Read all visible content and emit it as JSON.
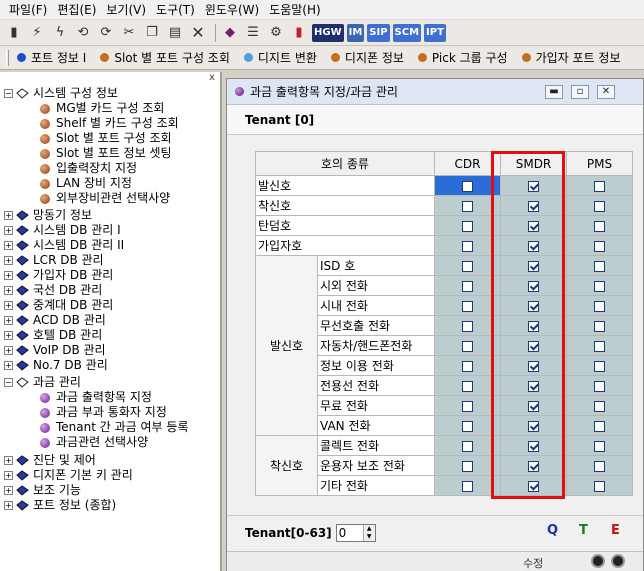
{
  "menu": [
    "파일(F)",
    "편집(E)",
    "보기(V)",
    "도구(T)",
    "윈도우(W)",
    "도움말(H)"
  ],
  "toolbar_badges": {
    "hgw": "HGW",
    "im": "IM",
    "sip": "SIP",
    "scm": "SCM",
    "ipt": "IPT"
  },
  "quickbar": [
    {
      "label": "포트 정보 I",
      "color": "#1a4fd0"
    },
    {
      "label": "Slot 별 포트 구성 조회",
      "color": "#c07020"
    },
    {
      "label": "디지트 변환",
      "color": "#4aa0e0"
    },
    {
      "label": "디지폰 정보",
      "color": "#c07020"
    },
    {
      "label": "Pick 그룹 구성",
      "color": "#c07020"
    },
    {
      "label": "가입자 포트 정보",
      "color": "#c07020"
    }
  ],
  "tree": {
    "close": "x",
    "system_config": "시스템 구성 정보",
    "system_children": [
      "MG별 카드 구성 조회",
      "Shelf 별 카드 구성 조회",
      "Slot 별 포트 구성 조회",
      "Slot 별 포트 정보 셋팅",
      "입출력장치 지정",
      "LAN 장비 지정",
      "외부장비관련 선택사양"
    ],
    "groups_mid": [
      "망동기 정보",
      "시스템 DB 관리 I",
      "시스템 DB 관리 II",
      "LCR DB 관리",
      "가입자 DB 관리",
      "국선 DB 관리",
      "중계대 DB 관리",
      "ACD DB 관리",
      "호텔 DB 관리",
      "VoIP DB 관리",
      "No.7 DB 관리"
    ],
    "billing": "과금 관리",
    "billing_children": [
      "과금 출력항목 지정",
      "과금 부과 통화자 지정",
      "Tenant 간 과금 여부 등록",
      "과금관련 선택사양"
    ],
    "groups_end": [
      "진단 및 제어",
      "디지폰 기본 키 관리",
      "보조 기능",
      "포트 정보 (종합)"
    ]
  },
  "window": {
    "title": "과금 출력항목 지정/과금 관리",
    "tenant": "Tenant [0]",
    "tenant_range_label": "Tenant[0-63]",
    "tenant_value": "0",
    "save": "수정"
  },
  "grid": {
    "header": {
      "type": "호의 종류",
      "cdr": "CDR",
      "smdr": "SMDR",
      "pms": "PMS"
    },
    "group_outgoing": "발신호",
    "group_incoming": "착신호",
    "rows": [
      {
        "name": "발신호",
        "group": null,
        "cdr": false,
        "smdr": true,
        "pms": false,
        "cdr_focus": true
      },
      {
        "name": "착신호",
        "group": null,
        "cdr": false,
        "smdr": true,
        "pms": false
      },
      {
        "name": "탄덤호",
        "group": null,
        "cdr": false,
        "smdr": true,
        "pms": false
      },
      {
        "name": "가입자호",
        "group": null,
        "cdr": false,
        "smdr": true,
        "pms": false
      },
      {
        "name": "ISD 호",
        "group": "out",
        "cdr": false,
        "smdr": true,
        "pms": false
      },
      {
        "name": "시외 전화",
        "group": "out",
        "cdr": false,
        "smdr": true,
        "pms": false
      },
      {
        "name": "시내 전화",
        "group": "out",
        "cdr": false,
        "smdr": true,
        "pms": false
      },
      {
        "name": "무선호출 전화",
        "group": "out",
        "cdr": false,
        "smdr": true,
        "pms": false
      },
      {
        "name": "자동차/핸드폰전화",
        "group": "out",
        "cdr": false,
        "smdr": true,
        "pms": false
      },
      {
        "name": "정보 이용 전화",
        "group": "out",
        "cdr": false,
        "smdr": true,
        "pms": false
      },
      {
        "name": "전용선 전화",
        "group": "out",
        "cdr": false,
        "smdr": true,
        "pms": false
      },
      {
        "name": "무료 전화",
        "group": "out",
        "cdr": false,
        "smdr": true,
        "pms": false
      },
      {
        "name": "VAN 전화",
        "group": "out",
        "cdr": false,
        "smdr": true,
        "pms": false
      },
      {
        "name": "콜렉트 전화",
        "group": "in",
        "cdr": false,
        "smdr": true,
        "pms": false
      },
      {
        "name": "운용자 보조 전화",
        "group": "in",
        "cdr": false,
        "smdr": true,
        "pms": false
      },
      {
        "name": "기타 전화",
        "group": "in",
        "cdr": false,
        "smdr": true,
        "pms": false
      }
    ]
  },
  "actions": {
    "q": "Q",
    "t": "T",
    "e": "E"
  },
  "colors": {
    "highlight": "#e01010",
    "row_shade": "#bccdd0"
  }
}
